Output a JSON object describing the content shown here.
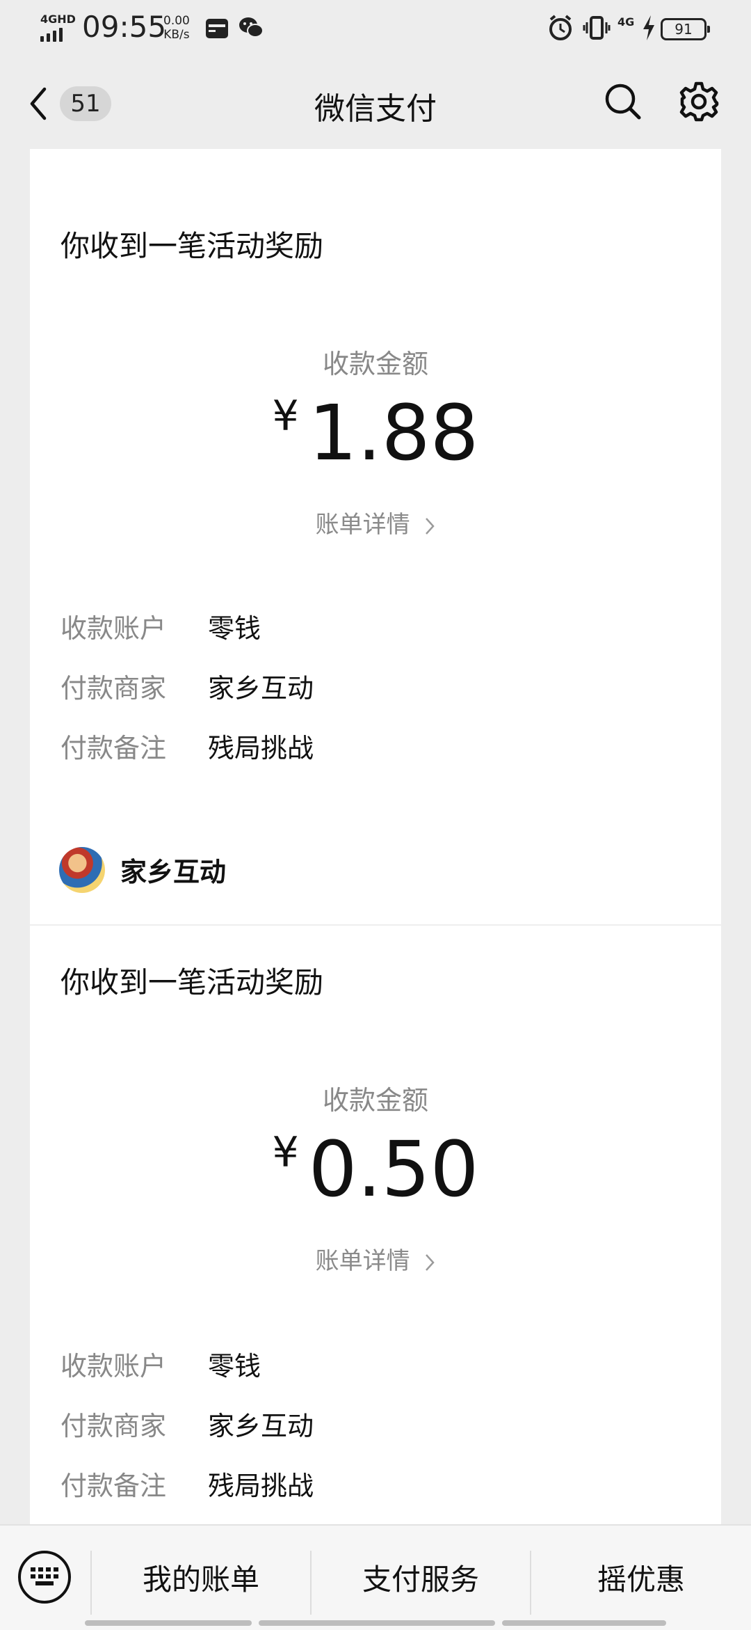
{
  "status_bar": {
    "network": "4GHD",
    "time": "09:55",
    "speed_value": "0.00",
    "speed_unit": "KB/s",
    "mobile": "4G",
    "battery": "91"
  },
  "header": {
    "unread_count": "51",
    "title": "微信支付"
  },
  "cards": [
    {
      "message_title": "你收到一笔活动奖励",
      "amount_label": "收款金额",
      "currency": "¥",
      "amount": "1.88",
      "detail_link": "账单详情",
      "rows": [
        {
          "key": "收款账户",
          "value": "零钱"
        },
        {
          "key": "付款商家",
          "value": "家乡互动"
        },
        {
          "key": "付款备注",
          "value": "残局挑战"
        }
      ]
    },
    {
      "merchant_name": "家乡互动",
      "message_title": "你收到一笔活动奖励",
      "amount_label": "收款金额",
      "currency": "¥",
      "amount": "0.50",
      "detail_link": "账单详情",
      "rows": [
        {
          "key": "收款账户",
          "value": "零钱"
        },
        {
          "key": "付款商家",
          "value": "家乡互动"
        },
        {
          "key": "付款备注",
          "value": "残局挑战"
        }
      ]
    }
  ],
  "bottom_menu": {
    "items": [
      "我的账单",
      "支付服务",
      "摇优惠"
    ]
  }
}
